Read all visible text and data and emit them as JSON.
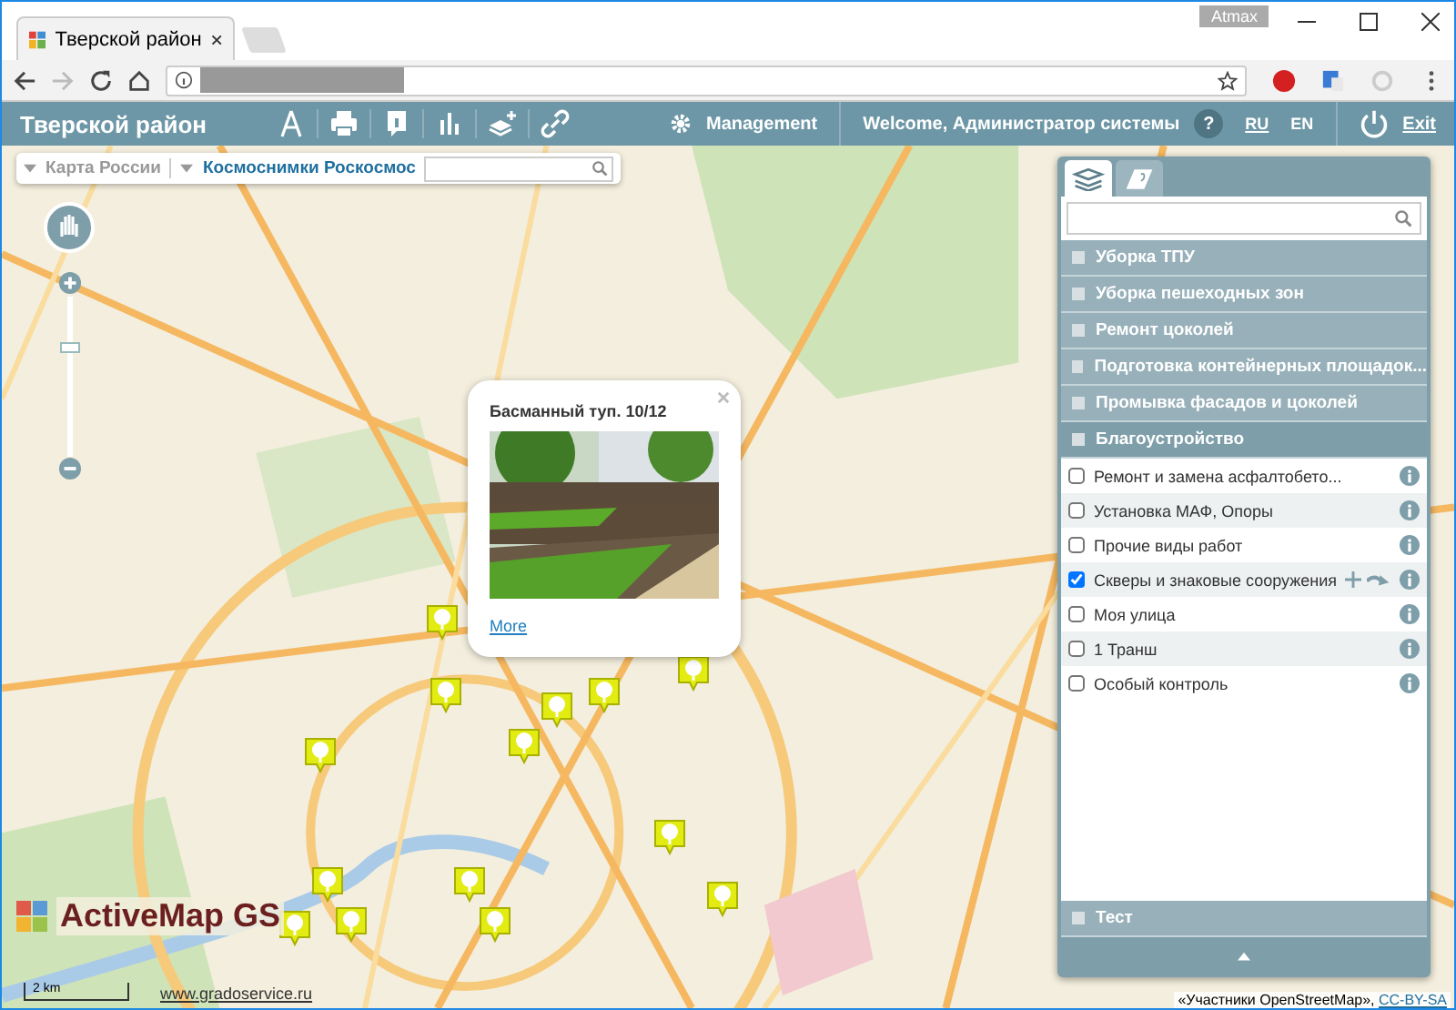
{
  "browser": {
    "tab_title": "Тверской район",
    "profile": "Atmax"
  },
  "header": {
    "title": "Тверской район",
    "management": "Management",
    "welcome": "Welcome, Администратор системы",
    "help": "?",
    "languages": [
      {
        "label": "RU",
        "selected": true
      },
      {
        "label": "EN",
        "selected": false
      }
    ],
    "exit": "Exit"
  },
  "basemaps": {
    "items": [
      {
        "label": "Карта России",
        "selected": false
      },
      {
        "label": "Космоснимки Роскосмос",
        "selected": true
      }
    ]
  },
  "popup": {
    "title": "Басманный туп. 10/12",
    "link": "More"
  },
  "panel": {
    "tabs": [
      {
        "selected": true
      },
      {
        "selected": false
      }
    ],
    "groups": [
      {
        "label": "Уборка ТПУ",
        "expanded": false
      },
      {
        "label": "Уборка пешеходных зон",
        "expanded": false
      },
      {
        "label": "Ремонт цоколей",
        "expanded": false
      },
      {
        "label": "Подготовка контейнерных площадок...",
        "expanded": false
      },
      {
        "label": "Промывка фасадов и цоколей",
        "expanded": false
      },
      {
        "label": "Благоустройство",
        "expanded": true,
        "children": [
          {
            "label": "Ремонт и замена асфалтобето...",
            "checked": false,
            "hovered": false
          },
          {
            "label": "Установка МАФ, Опоры",
            "checked": false,
            "hovered": false
          },
          {
            "label": "Прочие виды работ",
            "checked": false,
            "hovered": false
          },
          {
            "label": "Скверы и знаковые сооружения",
            "checked": true,
            "hovered": true
          },
          {
            "label": "Моя улица",
            "checked": false,
            "hovered": false
          },
          {
            "label": "1 Транш",
            "checked": false,
            "hovered": false
          },
          {
            "label": "Особый контроль",
            "checked": false,
            "hovered": false
          }
        ]
      }
    ],
    "footer_groups": [
      {
        "label": "Тест",
        "expanded": false
      }
    ]
  },
  "map": {
    "zoom": {
      "level": 0.7
    },
    "logo": "ActiveMap GS",
    "scale": "2 km",
    "website": "www.gradoservice.ru",
    "attribution": "«Участники OpenStreetMap»,",
    "license": "CC-BY-SA"
  }
}
